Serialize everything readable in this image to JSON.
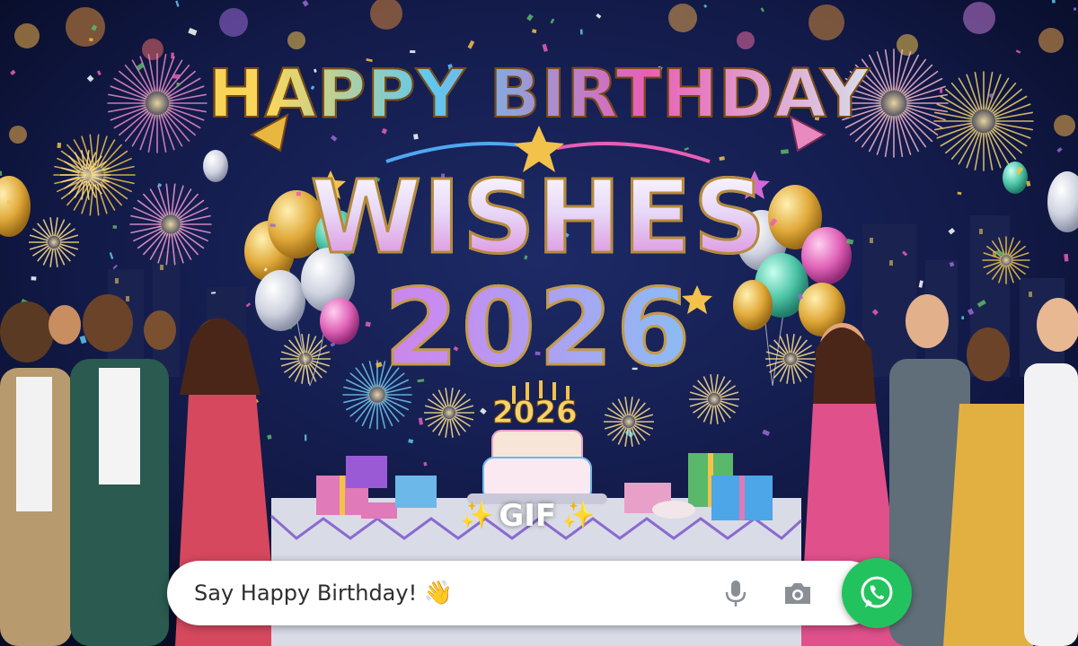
{
  "banner": {
    "line1": "HAPPY BIRTHDAY",
    "line2": "WISHES",
    "line3": "2026",
    "cake_number": "2026",
    "gif_label": "GIF",
    "sparkle_left": "✨",
    "sparkle_right": "✨"
  },
  "chat": {
    "input_text": "Say Happy Birthday!",
    "input_emoji": "👋",
    "mic_icon": "microphone-icon",
    "camera_icon": "camera-icon",
    "send_icon": "whatsapp-icon"
  },
  "colors": {
    "background": "#0b1236",
    "send_button": "#22c35e",
    "chat_bar": "#ffffff"
  }
}
